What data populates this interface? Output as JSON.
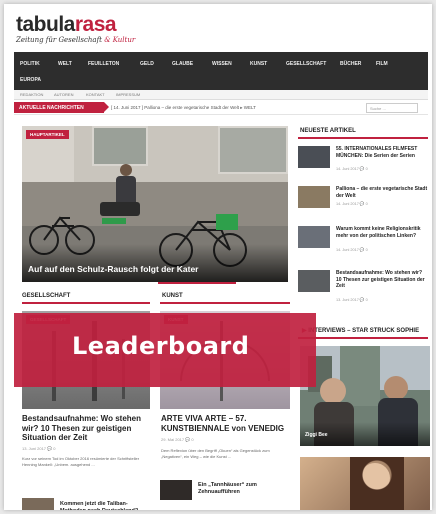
{
  "brand": {
    "name_part1": "tabula",
    "name_part2": "rasa",
    "tagline_a": "Zeitung für Gesellschaft ",
    "tagline_b": "& Kultur"
  },
  "main_nav": {
    "items": [
      {
        "label": "POLITIK"
      },
      {
        "label": "WELT"
      },
      {
        "label": "FEUILLETON"
      },
      {
        "label": "GELD"
      },
      {
        "label": "GLAUBE"
      },
      {
        "label": "WISSEN"
      },
      {
        "label": "KUNST"
      },
      {
        "label": "GESELLSCHAFT"
      },
      {
        "label": "BÜCHER"
      },
      {
        "label": "FILM"
      },
      {
        "label": "EUROPA"
      }
    ]
  },
  "sub_nav": {
    "items": [
      {
        "label": "REDAKTION"
      },
      {
        "label": "AUTOREN"
      },
      {
        "label": "KONTAKT"
      },
      {
        "label": "IMPRESSUM"
      }
    ]
  },
  "ticker": {
    "label": "AKTUELLE NACHRICHTEN",
    "text": "[ 14. Juni 2017 ] Palliona – die erste vegetarische Stadt der Welt ▸ WELT",
    "search_placeholder": "Suche ..."
  },
  "hero": {
    "badge": "HAUPTARTIKEL",
    "caption": "Auf auf den Schulz-Rausch folgt der Kater"
  },
  "sidebar": {
    "heading": "NEUESTE ARTIKEL",
    "articles": [
      {
        "title": "55. INTERNATIONALES FILMFEST MÜNCHEN: Die Serien der Serien",
        "meta": "14. Juni 2017  💬 0"
      },
      {
        "title": "Palliona – die erste vegetarische Stadt der Welt",
        "meta": "14. Juni 2017  💬 0"
      },
      {
        "title": "Warum kommt keine Religionskritik mehr von der politischen Linken?",
        "meta": "14. Juni 2017  💬 0"
      },
      {
        "title": "Bestandsaufnahme: Wo stehen wir? 10 Thesen zur geistigen Situation der Zeit",
        "meta": "13. Juni 2017  💬 0"
      }
    ],
    "interviews_heading": "INTERVIEWS – STAR STRUCK SOPHIE",
    "interviews_caption": "Ziggi Bee"
  },
  "gesellschaft": {
    "heading": "GESELLSCHAFT",
    "badge": "GESELLSCHAFT",
    "title": "Bestandsaufnahme: Wo stehen wir? 10 Thesen zur geistigen Situation der Zeit",
    "meta": "13. Juni 2017  💬 0",
    "excerpt": "Kurz vor seinem Tod im Oktober 2016 resümierte der Schriftsteller Henning Mankell: „Unbem. ausgehend ...",
    "small_title": "Kommen jetzt die Taliban-Methoden nach Deutschland?"
  },
  "kunst": {
    "heading": "KUNST",
    "badge": "KUNST",
    "title": "ARTE VIVA ARTE – 57. KUNSTBIENNALE von VENEDIG",
    "meta": "29. Mai 2017  💬 0",
    "excerpt": "Dem Reflexion über den Begriff „Okuen“ als Gegenstück zum „Negativen“, ein Weg – wie die Kunst ...",
    "small_title": "Ein „Tannhäuser“ zum Zehnuaufführen"
  },
  "ad": {
    "label": "Leaderboard"
  }
}
